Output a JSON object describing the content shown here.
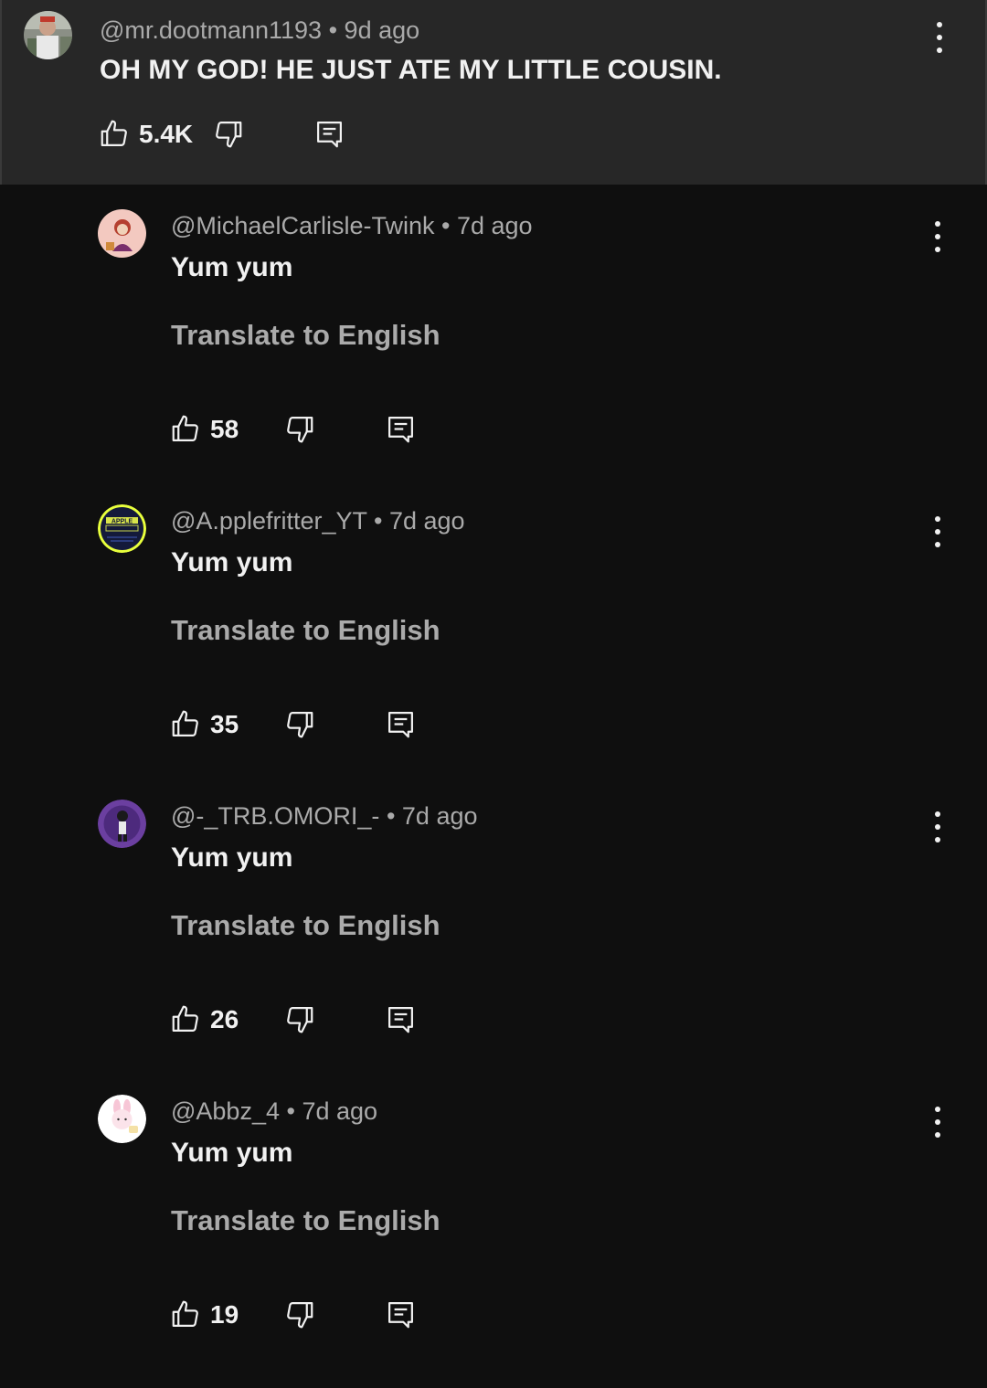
{
  "parent": {
    "handle": "@mr.dootmann1193",
    "time": "9d ago",
    "text": "OH MY GOD! HE JUST ATE MY LITTLE COUSIN.",
    "likes": "5.4K",
    "avatar_icon": "user-photo-avatar"
  },
  "replies": [
    {
      "handle": "@MichaelCarlisle-Twink",
      "time": "7d ago",
      "text": "Yum yum",
      "translate": "Translate to English",
      "likes": "58",
      "avatar_icon": "cartoon-character-avatar"
    },
    {
      "handle": "@A.pplefritter_YT",
      "time": "7d ago",
      "text": "Yum yum",
      "translate": "Translate to English",
      "likes": "35",
      "avatar_icon": "apple-fritter-logo-avatar"
    },
    {
      "handle": "@-_TRB.OMORI_-",
      "time": "7d ago",
      "text": "Yum yum",
      "translate": "Translate to English",
      "likes": "26",
      "avatar_icon": "purple-character-avatar"
    },
    {
      "handle": "@Abbz_4",
      "time": "7d ago",
      "text": "Yum yum",
      "translate": "Translate to English",
      "likes": "19",
      "avatar_icon": "pink-bunny-avatar"
    }
  ],
  "separator": "•",
  "colors": {
    "background": "#0f0f0f",
    "highlight": "#272727",
    "secondary_text": "#aaaaaa",
    "primary_text": "#f1f1f1"
  }
}
